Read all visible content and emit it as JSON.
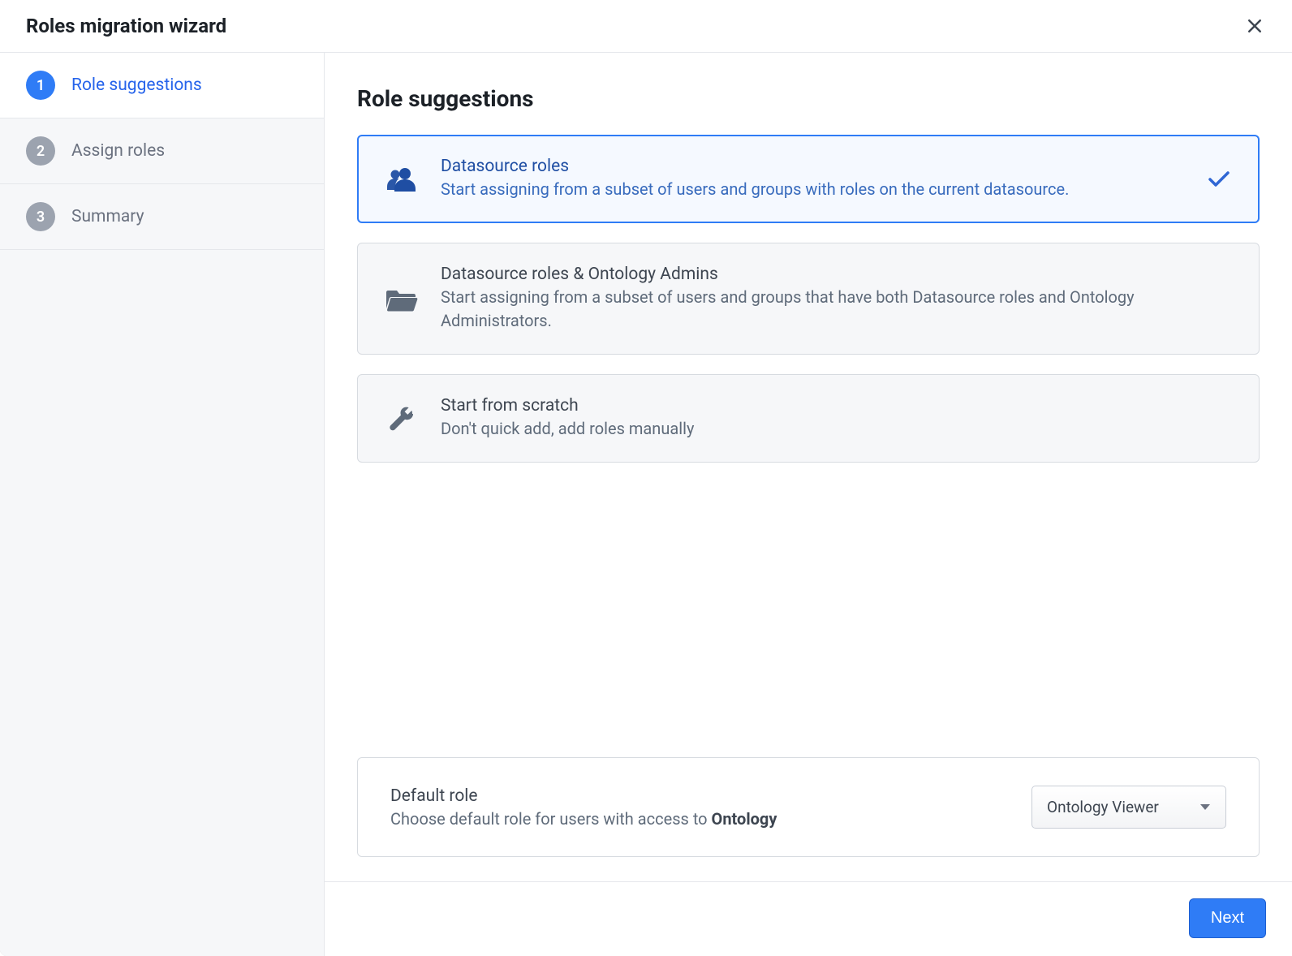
{
  "header": {
    "title": "Roles migration wizard"
  },
  "sidebar": {
    "steps": [
      {
        "number": "1",
        "label": "Role suggestions",
        "active": true
      },
      {
        "number": "2",
        "label": "Assign roles",
        "active": false
      },
      {
        "number": "3",
        "label": "Summary",
        "active": false
      }
    ]
  },
  "main": {
    "heading": "Role suggestions",
    "options": [
      {
        "icon": "people-icon",
        "title": "Datasource roles",
        "description": "Start assigning from a subset of users and groups with roles on the current datasource.",
        "selected": true
      },
      {
        "icon": "folder-open-icon",
        "title": "Datasource roles & Ontology Admins",
        "description": "Start assigning from a subset of users and groups that have both Datasource roles and Ontology Administrators.",
        "selected": false
      },
      {
        "icon": "wrench-icon",
        "title": "Start from scratch",
        "description": "Don't quick add, add roles manually",
        "selected": false
      }
    ],
    "default_role": {
      "title": "Default role",
      "description_prefix": "Choose default role for users with access to ",
      "description_bold": "Ontology",
      "select_value": "Ontology Viewer"
    }
  },
  "footer": {
    "next_label": "Next"
  },
  "colors": {
    "accent": "#2f7cf6",
    "text_muted": "#5f6b7a",
    "border": "#d7dbe0"
  },
  "icons": {
    "close": "close-icon",
    "check": "check-icon",
    "caret": "caret-down-icon"
  }
}
